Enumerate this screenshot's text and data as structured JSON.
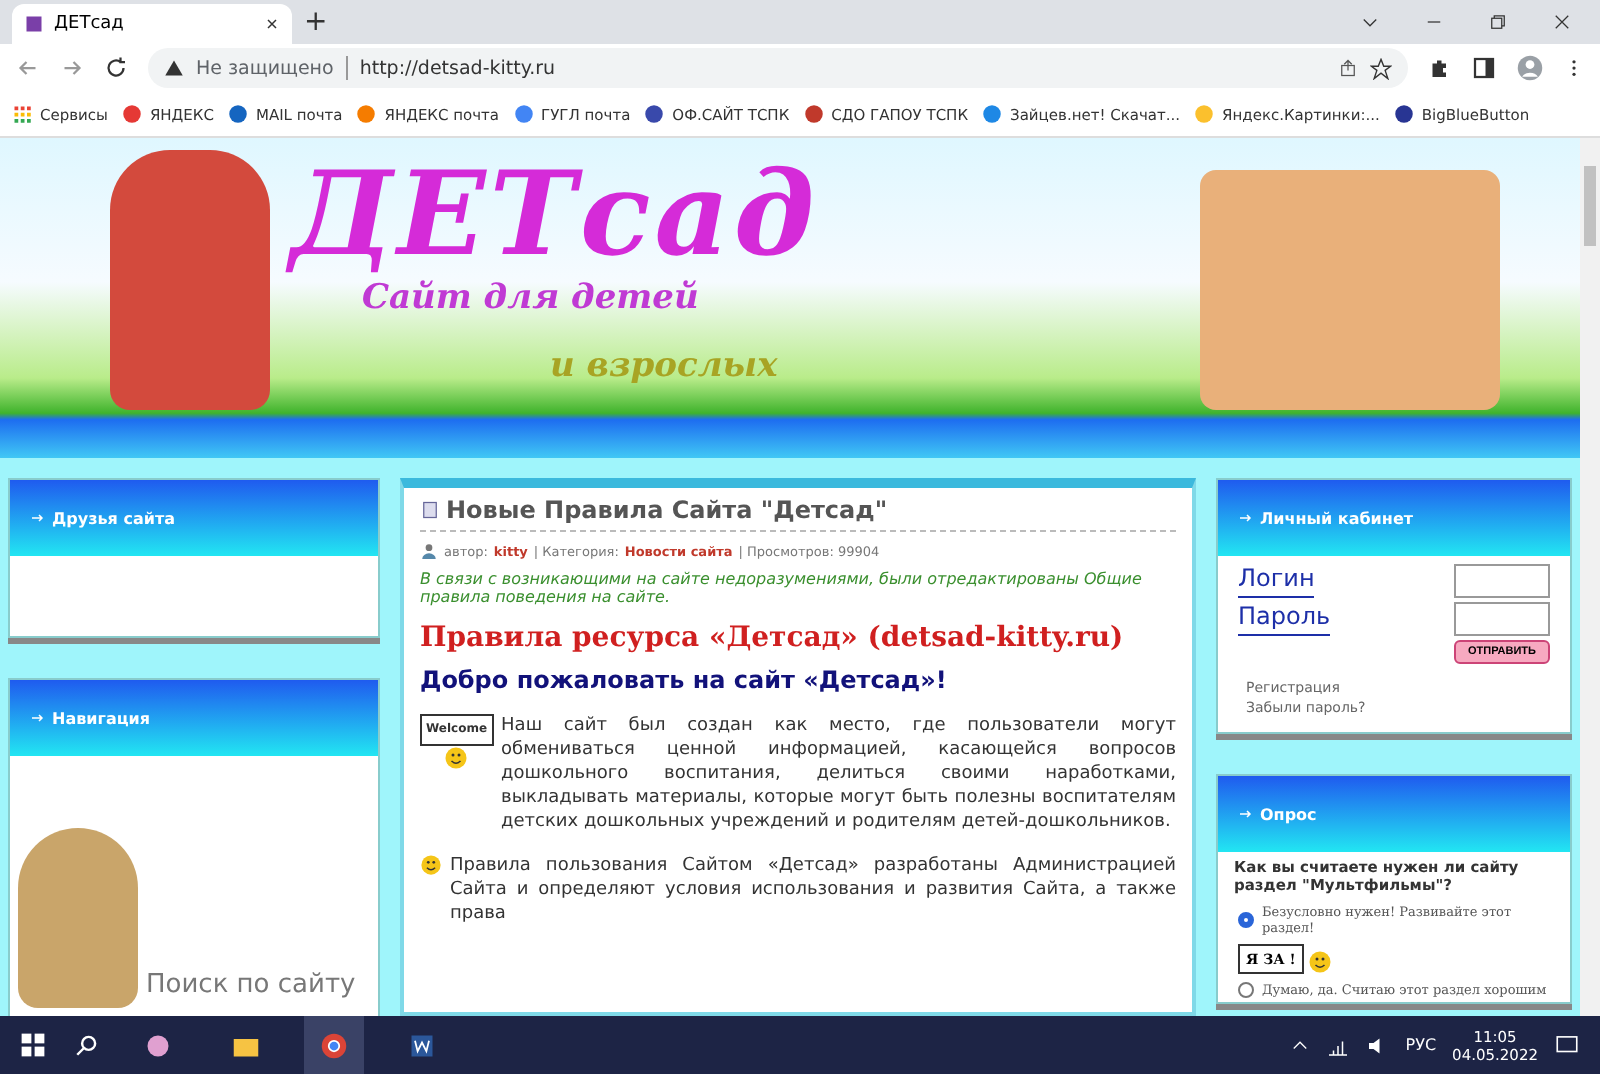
{
  "browser": {
    "tab_title": "ДЕТсад",
    "new_tab": "+",
    "security": "Не защищено",
    "url": "http://detsad-kitty.ru",
    "bookmarks": [
      {
        "label": "Сервисы"
      },
      {
        "label": "ЯНДЕКС"
      },
      {
        "label": "MAIL почта"
      },
      {
        "label": "ЯНДЕКС почта"
      },
      {
        "label": "ГУГЛ почта"
      },
      {
        "label": "ОФ.САЙТ ТСПК"
      },
      {
        "label": "СДО ГАПОУ ТСПК"
      },
      {
        "label": "Зайцев.нет! Скачат..."
      },
      {
        "label": "Яндекс.Картинки:..."
      },
      {
        "label": "BigBlueButton"
      }
    ]
  },
  "banner": {
    "logo": "ДЕТсад",
    "subtitle": "Сайт для детей",
    "subtitle_2": "и взрослых"
  },
  "left": {
    "friends": {
      "title": "Друзья сайта"
    },
    "navigation": {
      "title": "Навигация",
      "search_label": "Поиск по сайту"
    }
  },
  "article": {
    "title": "Новые Правила Сайта \"Детсад\"",
    "author_label": "автор:",
    "author": "kitty",
    "category_label": "| Категория:",
    "category": "Новости сайта",
    "views": "| Просмотров: 99904",
    "notice": "В связи с возникающими на сайте недоразумениями, были отредактированы Общие правила поведения на сайте.",
    "heading": "Правила ресурса «Детсад» (detsad-kitty.ru)",
    "welcome": "Добро пожаловать на сайт «Детсад»!",
    "sign": "Welcome",
    "paragraphs": [
      "Наш сайт был создан как место, где пользователи могут обмениваться ценной информацией, касающейся вопросов дошкольного воспитания, делиться своими наработками, выкладывать материалы, которые могут быть полезны воспитателям детских дошкольных учреждений и родителям детей-дошкольников.",
      "Правила пользования Сайтом «Детсад» разработаны Администрацией Сайта и определяют условия использования и развития Сайта, а также права"
    ]
  },
  "right": {
    "cabinet": {
      "title": "Личный кабинет",
      "login_label": "Логин",
      "password_label": "Пароль",
      "submit": "ОТПРАВИТЬ",
      "links": [
        "Регистрация",
        "Забыли пароль?"
      ]
    },
    "poll": {
      "title": "Опрос",
      "question": "Как вы считаете нужен ли сайту раздел \"Мультфильмы\"?",
      "sign": "Я ЗА !",
      "options": [
        {
          "label": "Безусловно нужен! Развивайте этот раздел!",
          "selected": true
        },
        {
          "label": "Думаю, да. Считаю этот раздел хорошим",
          "selected": false
        }
      ]
    }
  },
  "taskbar": {
    "language": "РУС",
    "time": "11:05",
    "date": "04.05.2022"
  }
}
